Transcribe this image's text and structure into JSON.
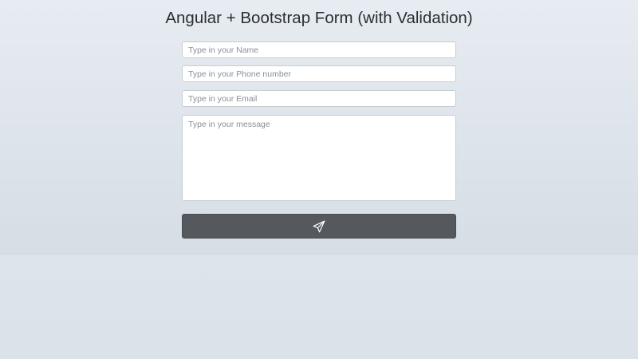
{
  "page": {
    "title": "Angular + Bootstrap Form (with Validation)"
  },
  "form": {
    "name_placeholder": "Type in your Name",
    "phone_placeholder": "Type in your Phone number",
    "email_placeholder": "Type in your Email",
    "message_placeholder": "Type in your message",
    "submit_icon": "paper-plane-icon"
  },
  "colors": {
    "button": "#55595e",
    "icon": "#ffffff",
    "title": "#2b2f33"
  }
}
